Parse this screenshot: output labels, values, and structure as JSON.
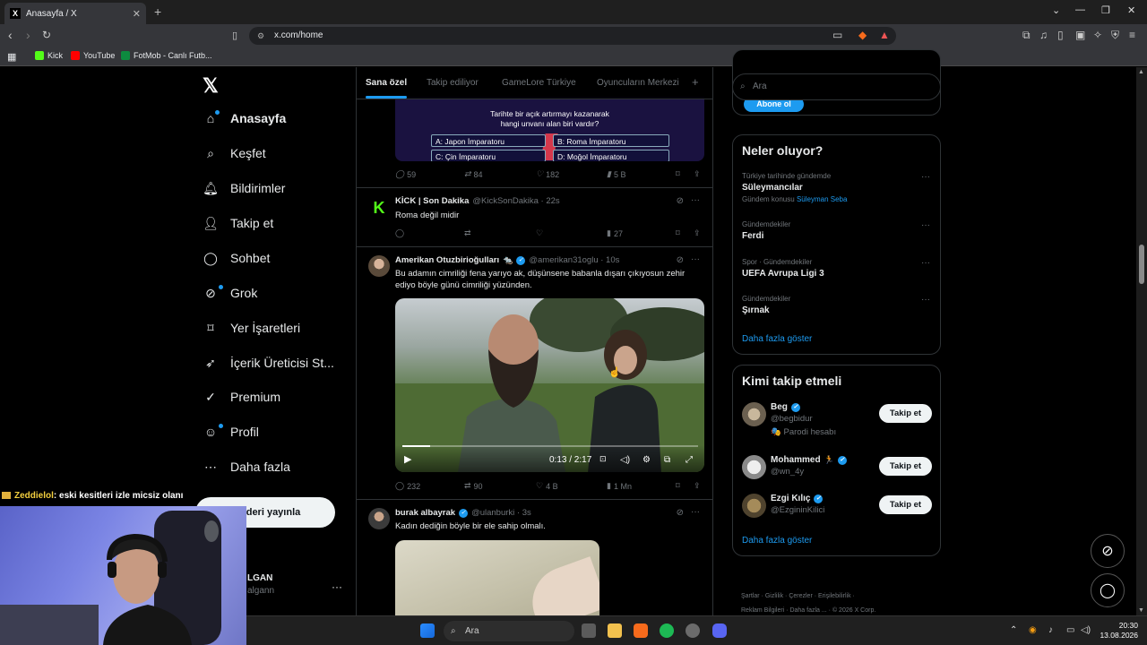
{
  "browser": {
    "tab_title": "Anasayfa / X",
    "url": "x.com/home",
    "bookmarks": [
      "Kick",
      "YouTube",
      "FotMob - Canlı Futb..."
    ]
  },
  "nav": {
    "items": [
      {
        "label": "Anasayfa",
        "icon": "home-icon",
        "active": true
      },
      {
        "label": "Keşfet",
        "icon": "search-icon"
      },
      {
        "label": "Bildirimler",
        "icon": "bell-icon"
      },
      {
        "label": "Takip et",
        "icon": "person-add-icon"
      },
      {
        "label": "Sohbet",
        "icon": "chat-icon"
      },
      {
        "label": "Grok",
        "icon": "grok-icon"
      },
      {
        "label": "Yer İşaretleri",
        "icon": "bookmark-icon"
      },
      {
        "label": "İçerik Üreticisi St...",
        "icon": "rocket-icon"
      },
      {
        "label": "Premium",
        "icon": "verified-icon"
      },
      {
        "label": "Profil",
        "icon": "profile-icon"
      },
      {
        "label": "Daha fazla",
        "icon": "more-circle-icon"
      }
    ],
    "publish_label": "nderi yayınla",
    "account_name": "LGAN",
    "account_handle": "algann"
  },
  "feed": {
    "tabs": [
      "Sana özel",
      "Takip ediliyor",
      "GameLore Türkiye",
      "Oyuncuların Merkezi"
    ],
    "quiz": {
      "question_line1": "Tarihte bir açık artırmayı kazanarak",
      "question_line2": "hangi unvanı alan biri vardır?",
      "options": [
        "A: Japon İmparatoru",
        "B: Roma İmparatoru",
        "C: Çin İmparatoru",
        "D: Moğol İmparatoru"
      ]
    },
    "post0_stats": {
      "replies": "59",
      "reposts": "84",
      "likes": "182",
      "views": "5 B"
    },
    "post1": {
      "name": "KİCK | Son Dakika",
      "handle": "@KickSonDakika · 22s",
      "text": "Roma değil midir",
      "views": "27"
    },
    "post2": {
      "name": "Amerikan Otuzbirioğulları",
      "handle": "@amerikan31oglu · 10s",
      "text": "Bu adamın cimriliği fena yarıyo ak, düşünsene babanla dışarı çıkıyosun zehir ediyo böyle günü cimriliği yüzünden.",
      "video_time": "0:13 / 2:17",
      "video_progress": 0.095,
      "replies": "232",
      "reposts": "90",
      "likes": "4 B",
      "views": "1 Mn"
    },
    "post3": {
      "name": "burak albayrak",
      "handle": "@ulanburki · 3s",
      "text": "Kadın dediğin böyle bir ele sahip olmalı."
    }
  },
  "right": {
    "search_placeholder": "Ara",
    "subscribe_label": "Abone ol",
    "trends_title": "Neler oluyor?",
    "trends": [
      {
        "meta": "Türkiye tarihinde gündemde",
        "name": "Süleymancılar",
        "sub_prefix": "Gündem konusu",
        "sub_link": "Süleyman Seba"
      },
      {
        "meta": "Gündemdekiler",
        "name": "Ferdi"
      },
      {
        "meta": "Spor · Gündemdekiler",
        "name": "UEFA Avrupa Ligi 3"
      },
      {
        "meta": "Gündemdekiler",
        "name": "Şırnak"
      }
    ],
    "show_more": "Daha fazla göster",
    "who_title": "Kimi takip etmeli",
    "who": [
      {
        "name": "Beg",
        "handle": "@begbidur",
        "extra": "Parodi hesabı"
      },
      {
        "name": "Mohammed",
        "handle": "@wn_4y"
      },
      {
        "name": "Ezgi Kılıç",
        "handle": "@EzgininKilici"
      }
    ],
    "follow_label": "Takip et",
    "footer_line1": [
      "Şartlar",
      "Gizlilik",
      "Çerezler",
      "Erişilebilirlik"
    ],
    "footer_line2": [
      "Reklam Bilgileri",
      "Daha fazla ...",
      "© 2026 X Corp."
    ]
  },
  "stream": {
    "chat_user": "Zeddielol",
    "chat_text": ": eski kesitleri izle micsiz olanı"
  },
  "taskbar": {
    "search_label": "Ara",
    "time": "20:30",
    "date": "13.08.2026"
  }
}
